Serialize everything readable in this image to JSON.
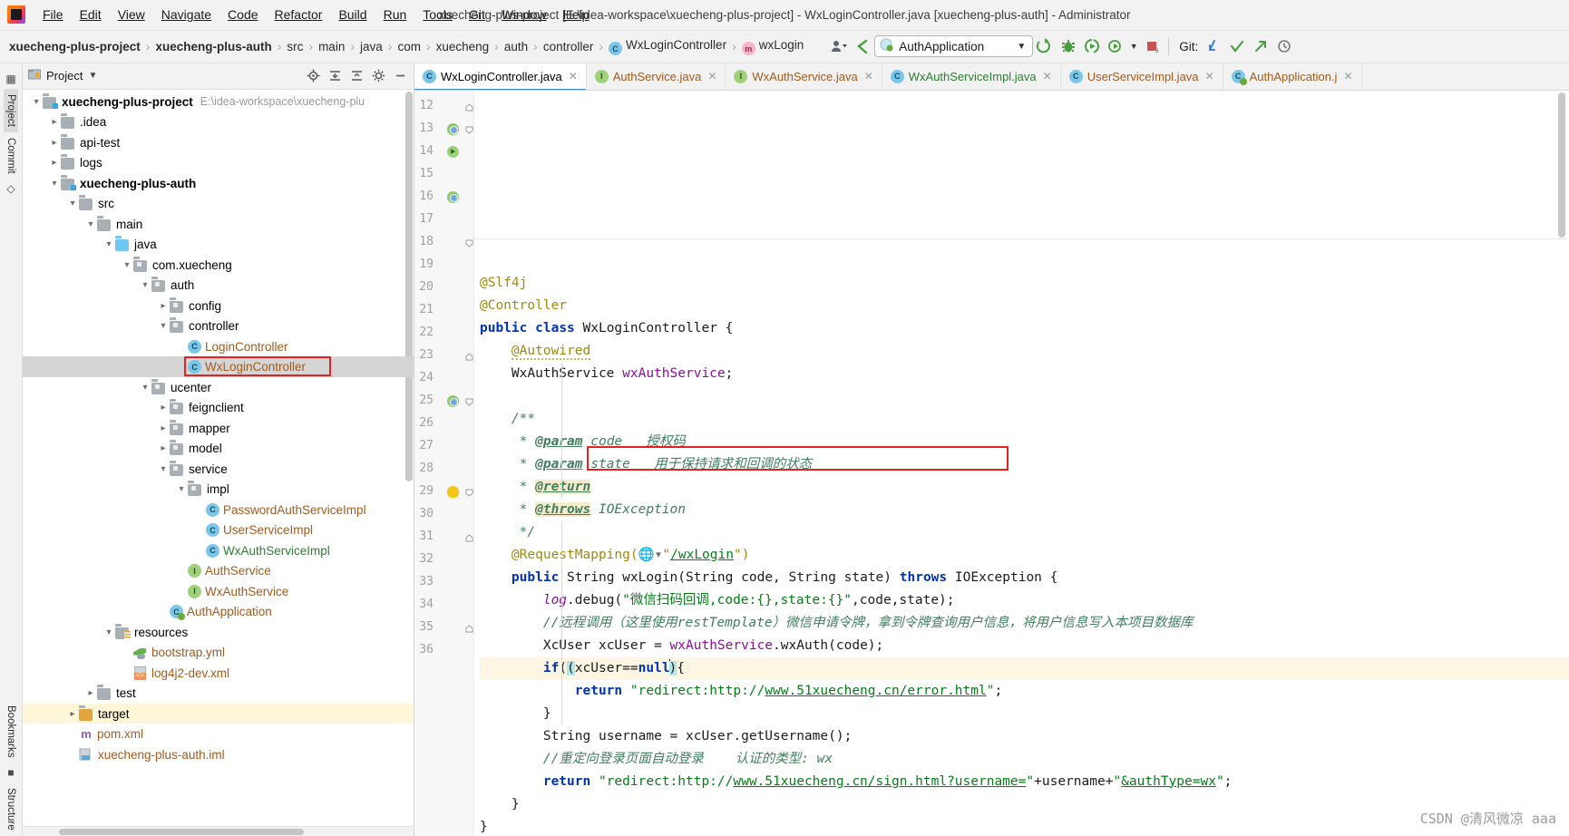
{
  "window": {
    "title": "xuecheng-plus-project [E:\\idea-workspace\\xuecheng-plus-project] - WxLoginController.java [xuecheng-plus-auth] - Administrator"
  },
  "menu": {
    "items": [
      "File",
      "Edit",
      "View",
      "Navigate",
      "Code",
      "Refactor",
      "Build",
      "Run",
      "Tools",
      "Git",
      "Window",
      "Help"
    ]
  },
  "breadcrumbs": [
    {
      "label": "xuecheng-plus-project",
      "bold": true,
      "icon": ""
    },
    {
      "label": "xuecheng-plus-auth",
      "bold": true,
      "icon": ""
    },
    {
      "label": "src",
      "bold": false,
      "icon": ""
    },
    {
      "label": "main",
      "bold": false,
      "icon": ""
    },
    {
      "label": "java",
      "bold": false,
      "icon": ""
    },
    {
      "label": "com",
      "bold": false,
      "icon": ""
    },
    {
      "label": "xuecheng",
      "bold": false,
      "icon": ""
    },
    {
      "label": "auth",
      "bold": false,
      "icon": ""
    },
    {
      "label": "controller",
      "bold": false,
      "icon": ""
    },
    {
      "label": "WxLoginController",
      "bold": false,
      "icon": "class-icon"
    },
    {
      "label": "wxLogin",
      "bold": false,
      "icon": "method-icon"
    }
  ],
  "toolbar": {
    "run_config": "AuthApplication",
    "git_label": "Git:",
    "icons": [
      "profiler-icon",
      "back-arrow-icon",
      "run-icon",
      "debug-icon",
      "run-with-coverage-icon",
      "profile-icon",
      "stop-icon",
      "update-project-icon",
      "commit-icon",
      "push-icon",
      "history-icon"
    ]
  },
  "leftstripe": {
    "items": [
      {
        "label": "Project",
        "name": "tool-window-project",
        "active": true
      },
      {
        "label": "Commit",
        "name": "tool-window-commit",
        "active": false
      },
      {
        "label": "Bookmarks",
        "name": "tool-window-bookmarks",
        "active": false
      },
      {
        "label": "Structure",
        "name": "tool-window-structure",
        "active": false
      }
    ]
  },
  "project_panel": {
    "title": "Project",
    "header_icons": [
      "locate-icon",
      "expand-all-icon",
      "collapse-all-icon",
      "settings-icon",
      "hide-icon"
    ],
    "tree": [
      {
        "depth": 0,
        "arrow": "open",
        "icon": "folder-module",
        "label": "xuecheng-plus-project",
        "bold": true,
        "color": "black",
        "path": "E:\\idea-workspace\\xuecheng-plu"
      },
      {
        "depth": 1,
        "arrow": "closed",
        "icon": "folder",
        "label": ".idea",
        "bold": false,
        "color": "black"
      },
      {
        "depth": 1,
        "arrow": "closed",
        "icon": "folder",
        "label": "api-test",
        "bold": false,
        "color": "black"
      },
      {
        "depth": 1,
        "arrow": "closed",
        "icon": "folder",
        "label": "logs",
        "bold": false,
        "color": "black"
      },
      {
        "depth": 1,
        "arrow": "open",
        "icon": "folder-module",
        "label": "xuecheng-plus-auth",
        "bold": true,
        "color": "black"
      },
      {
        "depth": 2,
        "arrow": "open",
        "icon": "folder",
        "label": "src",
        "bold": false,
        "color": "black"
      },
      {
        "depth": 3,
        "arrow": "open",
        "icon": "folder",
        "label": "main",
        "bold": false,
        "color": "black"
      },
      {
        "depth": 4,
        "arrow": "open",
        "icon": "folder-source",
        "label": "java",
        "bold": false,
        "color": "black"
      },
      {
        "depth": 5,
        "arrow": "open",
        "icon": "folder-package",
        "label": "com.xuecheng",
        "bold": false,
        "color": "black"
      },
      {
        "depth": 6,
        "arrow": "open",
        "icon": "folder-package",
        "label": "auth",
        "bold": false,
        "color": "black"
      },
      {
        "depth": 7,
        "arrow": "closed",
        "icon": "folder-package",
        "label": "config",
        "bold": false,
        "color": "black"
      },
      {
        "depth": 7,
        "arrow": "open",
        "icon": "folder-package",
        "label": "controller",
        "bold": false,
        "color": "black"
      },
      {
        "depth": 8,
        "arrow": "none",
        "icon": "class-icon",
        "label": "LoginController",
        "bold": false,
        "color": "orange"
      },
      {
        "depth": 8,
        "arrow": "none",
        "icon": "class-icon",
        "label": "WxLoginController",
        "bold": false,
        "color": "orange",
        "selected": true,
        "boxed": true
      },
      {
        "depth": 6,
        "arrow": "open",
        "icon": "folder-package",
        "label": "ucenter",
        "bold": false,
        "color": "black"
      },
      {
        "depth": 7,
        "arrow": "closed",
        "icon": "folder-package",
        "label": "feignclient",
        "bold": false,
        "color": "black"
      },
      {
        "depth": 7,
        "arrow": "closed",
        "icon": "folder-package",
        "label": "mapper",
        "bold": false,
        "color": "black"
      },
      {
        "depth": 7,
        "arrow": "closed",
        "icon": "folder-package",
        "label": "model",
        "bold": false,
        "color": "black"
      },
      {
        "depth": 7,
        "arrow": "open",
        "icon": "folder-package",
        "label": "service",
        "bold": false,
        "color": "black"
      },
      {
        "depth": 8,
        "arrow": "open",
        "icon": "folder-package",
        "label": "impl",
        "bold": false,
        "color": "black"
      },
      {
        "depth": 9,
        "arrow": "none",
        "icon": "class-icon",
        "label": "PasswordAuthServiceImpl",
        "bold": false,
        "color": "orange"
      },
      {
        "depth": 9,
        "arrow": "none",
        "icon": "class-icon",
        "label": "UserServiceImpl",
        "bold": false,
        "color": "orange"
      },
      {
        "depth": 9,
        "arrow": "none",
        "icon": "class-icon",
        "label": "WxAuthServiceImpl",
        "bold": false,
        "color": "green"
      },
      {
        "depth": 8,
        "arrow": "none",
        "icon": "interface-icon",
        "label": "AuthService",
        "bold": false,
        "color": "orange"
      },
      {
        "depth": 8,
        "arrow": "none",
        "icon": "interface-icon",
        "label": "WxAuthService",
        "bold": false,
        "color": "orange"
      },
      {
        "depth": 7,
        "arrow": "none",
        "icon": "spring-app-icon",
        "label": "AuthApplication",
        "bold": false,
        "color": "orange"
      },
      {
        "depth": 4,
        "arrow": "open",
        "icon": "folder-resources",
        "label": "resources",
        "bold": false,
        "color": "black"
      },
      {
        "depth": 5,
        "arrow": "none",
        "icon": "yml-icon",
        "label": "bootstrap.yml",
        "bold": false,
        "color": "orange"
      },
      {
        "depth": 5,
        "arrow": "none",
        "icon": "xml-icon",
        "label": "log4j2-dev.xml",
        "bold": false,
        "color": "orange"
      },
      {
        "depth": 3,
        "arrow": "closed",
        "icon": "folder",
        "label": "test",
        "bold": false,
        "color": "black"
      },
      {
        "depth": 2,
        "arrow": "closed",
        "icon": "folder-target",
        "label": "target",
        "bold": false,
        "color": "black",
        "highlighted": true
      },
      {
        "depth": 2,
        "arrow": "none",
        "icon": "maven-icon",
        "label": "pom.xml",
        "bold": false,
        "color": "orange"
      },
      {
        "depth": 2,
        "arrow": "none",
        "icon": "module-file-icon",
        "label": "xuecheng-plus-auth.iml",
        "bold": false,
        "color": "orange"
      }
    ]
  },
  "editor": {
    "tabs": [
      {
        "label": "WxLoginController.java",
        "icon": "class-icon",
        "color": "black",
        "active": true
      },
      {
        "label": "AuthService.java",
        "icon": "interface-icon",
        "color": "orange",
        "active": false
      },
      {
        "label": "WxAuthService.java",
        "icon": "interface-icon",
        "color": "orange",
        "active": false
      },
      {
        "label": "WxAuthServiceImpl.java",
        "icon": "class-icon",
        "color": "green",
        "active": false
      },
      {
        "label": "UserServiceImpl.java",
        "icon": "class-icon",
        "color": "orange",
        "active": false
      },
      {
        "label": "AuthApplication.j",
        "icon": "spring-app-icon",
        "color": "orange",
        "active": false
      }
    ],
    "first_line_number": 12,
    "lines": [
      {
        "n": 12,
        "gutter": "",
        "fold": "fold-end"
      },
      {
        "n": 13,
        "gutter": "bean-icon",
        "fold": "fold-start"
      },
      {
        "n": 14,
        "gutter": "run-icon",
        "fold": ""
      },
      {
        "n": 15,
        "gutter": "",
        "fold": ""
      },
      {
        "n": 16,
        "gutter": "bean-icon",
        "fold": ""
      },
      {
        "n": 17,
        "gutter": "",
        "fold": ""
      },
      {
        "n": 18,
        "gutter": "",
        "fold": "fold-start"
      },
      {
        "n": 19,
        "gutter": "",
        "fold": ""
      },
      {
        "n": 20,
        "gutter": "",
        "fold": ""
      },
      {
        "n": 21,
        "gutter": "",
        "fold": ""
      },
      {
        "n": 22,
        "gutter": "",
        "fold": ""
      },
      {
        "n": 23,
        "gutter": "",
        "fold": "fold-end"
      },
      {
        "n": 24,
        "gutter": "",
        "fold": ""
      },
      {
        "n": 25,
        "gutter": "bean-icon",
        "fold": "fold-start"
      },
      {
        "n": 26,
        "gutter": "",
        "fold": ""
      },
      {
        "n": 27,
        "gutter": "",
        "fold": ""
      },
      {
        "n": 28,
        "gutter": "",
        "fold": ""
      },
      {
        "n": 29,
        "gutter": "bulb-icon",
        "fold": "fold-start"
      },
      {
        "n": 30,
        "gutter": "",
        "fold": ""
      },
      {
        "n": 31,
        "gutter": "",
        "fold": "fold-end"
      },
      {
        "n": 32,
        "gutter": "",
        "fold": ""
      },
      {
        "n": 33,
        "gutter": "",
        "fold": ""
      },
      {
        "n": 34,
        "gutter": "",
        "fold": ""
      },
      {
        "n": 35,
        "gutter": "",
        "fold": "fold-end"
      },
      {
        "n": 36,
        "gutter": "",
        "fold": ""
      }
    ],
    "code": {
      "l12": "@Slf4j",
      "l13": "@Controller",
      "l14": "public class WxLoginController {",
      "l15": "    @Autowired",
      "l16": "    WxAuthService wxAuthService;",
      "l17": "",
      "l18": "    /**",
      "l19": "     * @param code   授权码",
      "l20": "     * @param state   用于保持请求和回调的状态",
      "l21": "     * @return",
      "l22": "     * @throws IOException",
      "l23": "     */",
      "l24": "    @RequestMapping(\"/wxLogin\")",
      "l25": "    public String wxLogin(String code, String state) throws IOException {",
      "l26": "        log.debug(\"微信扫码回调,code:{},state:{}\",code,state);",
      "l27": "        //远程调用（这里使用restTemplate）微信申请令牌，拿到令牌查询用户信息，将用户信息写入本项目数据库",
      "l28": "        XcUser xcUser = wxAuthService.wxAuth(code);",
      "l29": "        if(xcUser==null){",
      "l30": "            return \"redirect:http://www.51xuecheng.cn/error.html\";",
      "l31": "        }",
      "l32": "        String username = xcUser.getUsername();",
      "l33": "        //重定向登录页面自动登录    认证的类型: wx",
      "l34": "        return \"redirect:http://www.51xuecheng.cn/sign.html?username=\"+username+\"&authType=wx\";",
      "l35": "    }",
      "l36": "}"
    },
    "highlight_box_line": 28
  },
  "watermark": "CSDN @清风微凉 aaa",
  "colors": {
    "accent_blue": "#3f87d4",
    "redbox": "#e8201f",
    "keyword": "#0033b3",
    "string": "#067d17",
    "annotation": "#9e880d",
    "comment": "#8c8c8c",
    "field": "#871094",
    "selection": "#d5d5d5",
    "highlight_row": "#fdf6e3"
  }
}
